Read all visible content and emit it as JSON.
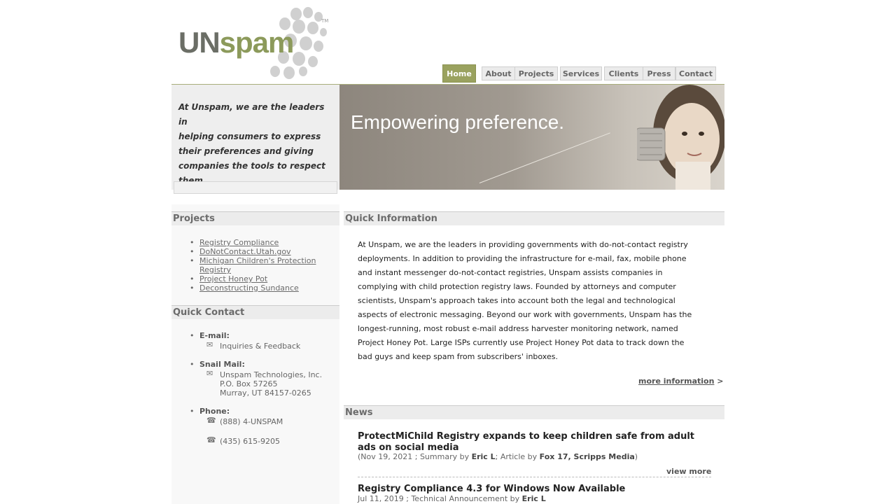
{
  "logo": {
    "part1": "UN",
    "part2": "spam",
    "tm": "TM"
  },
  "nav": {
    "items": [
      {
        "label": "Home"
      },
      {
        "label": "About"
      },
      {
        "label": "Projects"
      },
      {
        "label": "Services"
      },
      {
        "label": "Clients"
      },
      {
        "label": "Press"
      },
      {
        "label": "Contact"
      }
    ]
  },
  "intro": {
    "lines": [
      "At Unspam, we are the leaders in",
      "helping consumers to express",
      "their preferences and giving",
      "companies the tools to respect",
      "them."
    ]
  },
  "banner": {
    "tagline": "Empowering preference."
  },
  "projects": {
    "heading": "Projects",
    "items": [
      {
        "label": "Registry Compliance"
      },
      {
        "label": "DoNotContact.Utah.gov"
      },
      {
        "label": "Michigan Children's Protection"
      },
      {
        "label": "Registry"
      },
      {
        "label": "Project Honey Pot"
      },
      {
        "label": "Deconstructing Sundance"
      }
    ]
  },
  "quick_contact": {
    "heading": "Quick Contact",
    "email_label": "E-mail:",
    "email_link": "Inquiries & Feedback",
    "snail_label": "Snail Mail:",
    "address": [
      "Unspam Technologies, Inc.",
      "P.O. Box 57265",
      "Murray, UT 84157-0265"
    ],
    "phone_label": "Phone:",
    "phones": [
      "(888) 4-UNSPAM",
      "(435) 615-9205"
    ]
  },
  "quick_info": {
    "heading": "Quick Information",
    "lines": [
      "At Unspam, we are the leaders in providing governments with do-not-contact registry",
      "deployments. In addition to providing the infrastructure for e-mail, fax, mobile phone",
      "and instant messenger do-not-contact registries, Unspam assists companies in",
      "complying with child protection registry laws. Founded by attorneys and computer",
      "scientists, Unspam's approach takes into account both the legal and technological",
      "aspects of electronic messaging. Beyond our work with governments, Unspam has the",
      "longest-running, most robust e-mail address harvester monitoring network, named",
      "Project Honey Pot. Large ISPs currently use Project Honey Pot data to track down the",
      "bad guys and keep spam from subscribers' inboxes."
    ],
    "more_label": "more information",
    "more_arrow": ">"
  },
  "news": {
    "heading": "News",
    "items": [
      {
        "title": "ProtectMiChild Registry expands to keep children safe from adult ads on social media",
        "meta_open": "(Nov 19, 2021 ; Summary by ",
        "author": "Eric L",
        "meta_mid": "; Article by ",
        "source": "Fox 17, Scripps Media",
        "meta_close": ")"
      },
      {
        "title": "Registry Compliance 4.3 for Windows Now Available",
        "meta_open": "Jul 11, 2019 ; Technical Announcement by ",
        "author": "Eric L"
      }
    ],
    "view_more": "view more"
  }
}
